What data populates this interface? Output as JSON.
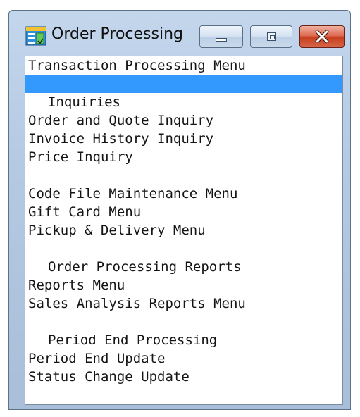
{
  "window": {
    "title": "Order Processing",
    "minimize_label": "Minimize",
    "maximize_label": "Maximize",
    "close_label": "Close"
  },
  "menu": {
    "title": "Transaction Processing Menu",
    "lines": [
      {
        "text": "",
        "kind": "selected"
      },
      {
        "text": "Inquiries",
        "kind": "heading"
      },
      {
        "text": "Order and Quote Inquiry",
        "kind": "item"
      },
      {
        "text": "Invoice History Inquiry",
        "kind": "item"
      },
      {
        "text": "Price Inquiry",
        "kind": "item"
      },
      {
        "text": "",
        "kind": "blank"
      },
      {
        "text": "Code File Maintenance Menu",
        "kind": "item"
      },
      {
        "text": "Gift Card Menu",
        "kind": "item"
      },
      {
        "text": "Pickup & Delivery Menu",
        "kind": "item"
      },
      {
        "text": "",
        "kind": "blank"
      },
      {
        "text": "Order Processing Reports",
        "kind": "heading"
      },
      {
        "text": "Reports Menu",
        "kind": "item"
      },
      {
        "text": "Sales Analysis Reports Menu",
        "kind": "item"
      },
      {
        "text": "",
        "kind": "blank"
      },
      {
        "text": "Period End Processing",
        "kind": "heading"
      },
      {
        "text": "Period End Update",
        "kind": "item"
      },
      {
        "text": "Status Change Update",
        "kind": "item"
      }
    ]
  },
  "colors": {
    "selection": "#3399ff",
    "close_button": "#c7401f",
    "frame": "#b4c9e2"
  }
}
